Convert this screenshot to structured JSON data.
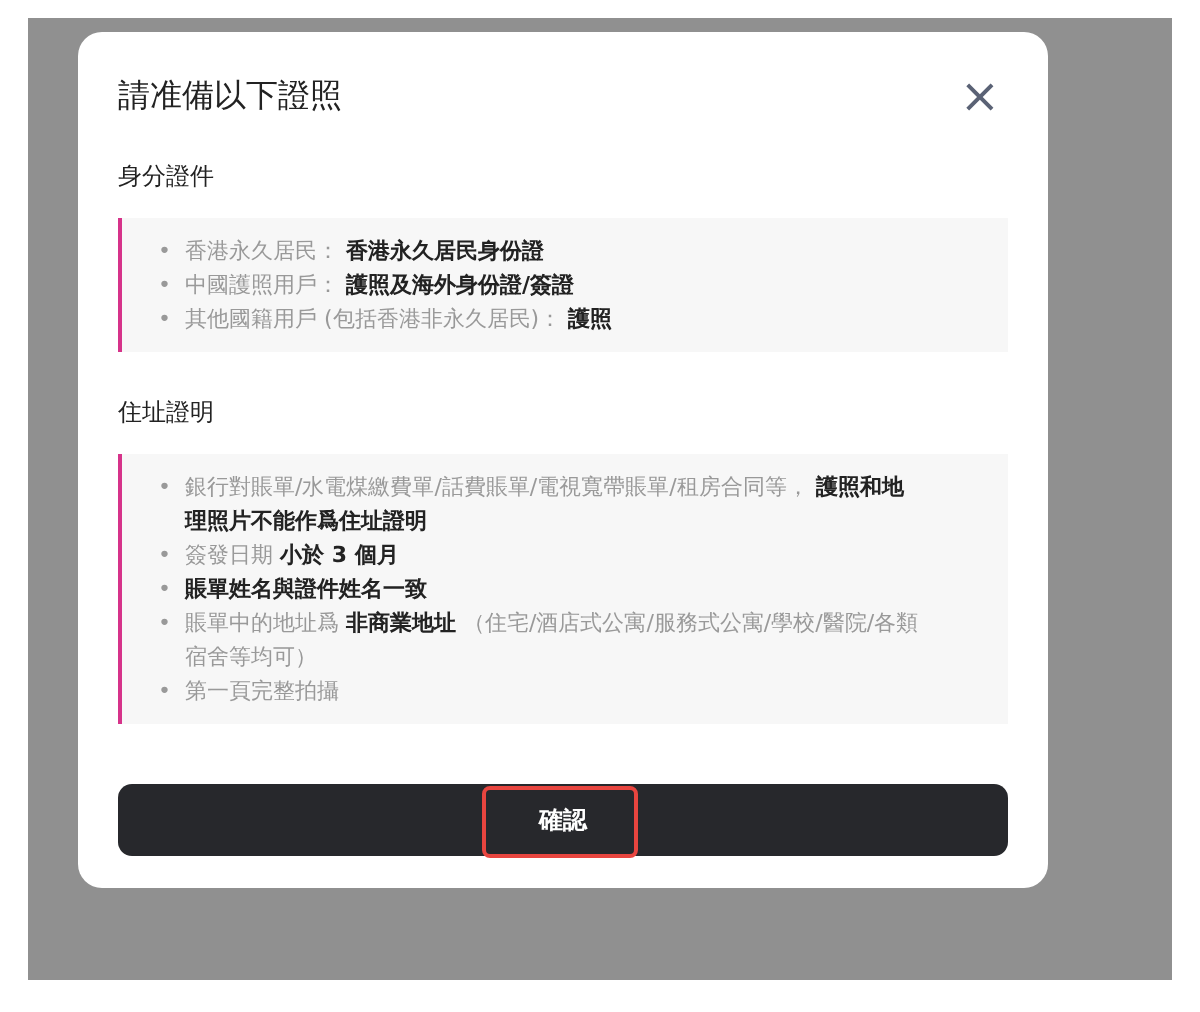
{
  "dialog": {
    "title": "請准備以下證照",
    "close_icon": "×",
    "sections": [
      {
        "heading": "身分證件",
        "items": [
          {
            "bullet": "•",
            "text": "香港永久居民： **香港永久居民身份證**"
          },
          {
            "bullet": "•",
            "text": "中國護照用戶： **護照及海外身份證/簽證**"
          },
          {
            "bullet": "•",
            "text": "其他國籍用戶 (包括香港非永久居民)： **護照**"
          }
        ]
      },
      {
        "heading": "住址證明",
        "items": [
          {
            "bullet": "•",
            "text": "銀行對賬單/水電煤繳費單/話費賬單/電視寬帶賬單/租房合同等， **護照和地理照片不能作爲住址證明**"
          },
          {
            "bullet": "•",
            "text": "簽發日期 **小於 3 個月**"
          },
          {
            "bullet": "•",
            "text": "**賬單姓名與證件姓名一致**"
          },
          {
            "bullet": "•",
            "text": "賬單中的地址爲 **非商業地址** （住宅/酒店式公寓/服務式公寓/學校/醫院/各類宿舍等均可）"
          },
          {
            "bullet": "•",
            "text": "第一頁完整拍攝"
          }
        ]
      }
    ],
    "confirm_button": {
      "label": "確認",
      "highlighted": true
    }
  }
}
